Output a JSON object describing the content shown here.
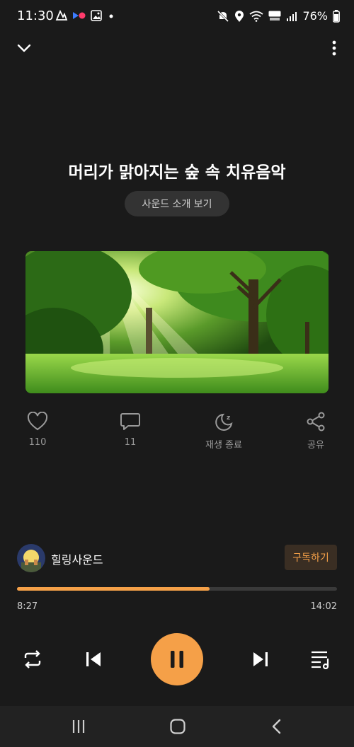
{
  "status_bar": {
    "time": "11:30",
    "battery": "76%",
    "icons": [
      "nfc-icon",
      "video-icon",
      "gallery-icon",
      "dot-icon",
      "mute-icon",
      "location-icon",
      "wifi-icon",
      "hd-voice-icon",
      "signal-icon",
      "battery-icon"
    ]
  },
  "header": {
    "collapse_icon": "chevron-down-icon",
    "more_icon": "more-vertical-icon"
  },
  "track": {
    "title": "머리가 맑아지는 숲 속 치유음악",
    "intro_button": "사운드 소개 보기",
    "artwork_description": "forest-sunlight"
  },
  "actions": [
    {
      "icon": "heart-icon",
      "label": "110"
    },
    {
      "icon": "comment-icon",
      "label": "11"
    },
    {
      "icon": "sleep-timer-icon",
      "label": "재생 종료"
    },
    {
      "icon": "share-icon",
      "label": "공유"
    }
  ],
  "channel": {
    "name": "힐링사운드",
    "subscribe_label": "구독하기"
  },
  "progress": {
    "current": "8:27",
    "total": "14:02",
    "fraction": 0.602
  },
  "controls": [
    "repeat-icon",
    "previous-icon",
    "pause-icon",
    "next-icon",
    "playlist-icon"
  ],
  "colors": {
    "accent": "#f5a048",
    "background": "#1a1a1a",
    "subscribe_bg": "#3a2e23"
  },
  "nav_bar": [
    "recent-apps-icon",
    "home-icon",
    "back-icon"
  ]
}
